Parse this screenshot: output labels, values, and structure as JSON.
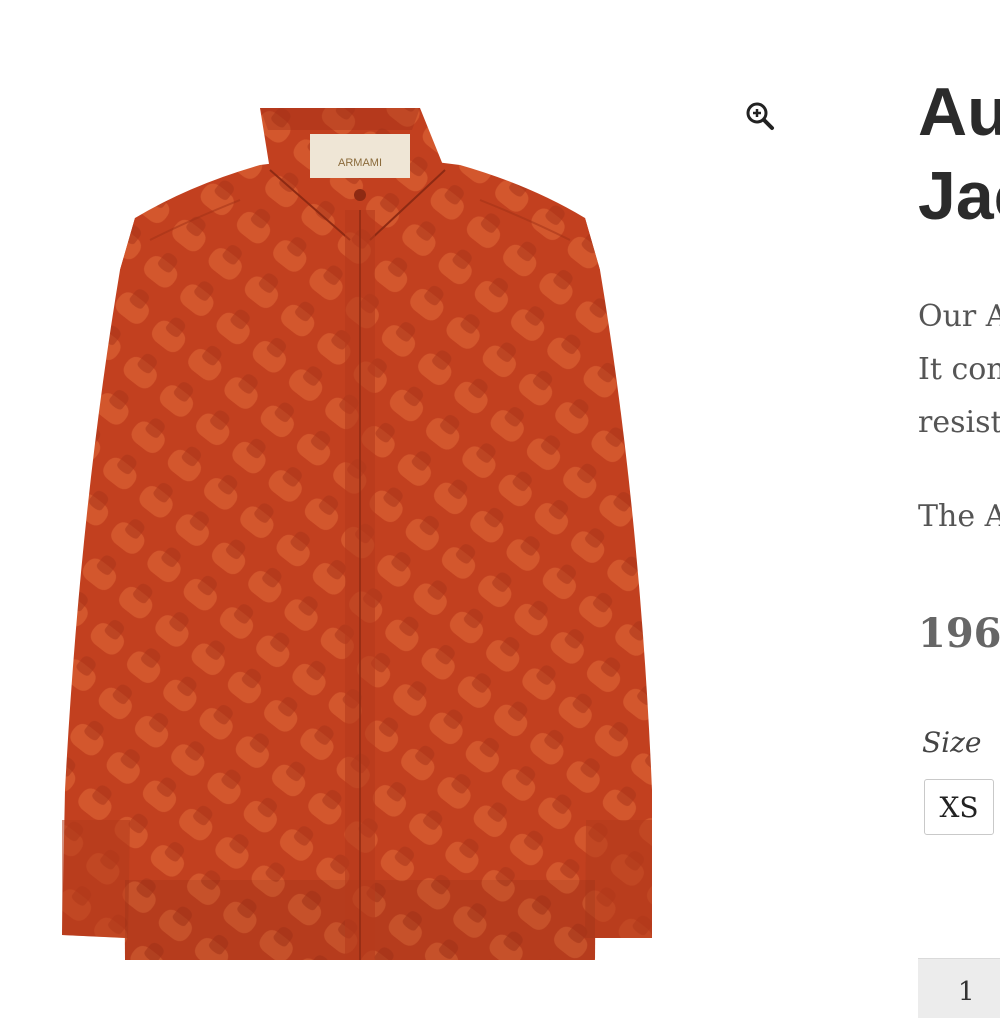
{
  "product": {
    "title_line1": "Au",
    "title_line2": "Jac",
    "description": {
      "line1": "Our A",
      "line2": "It con",
      "line3": "resist",
      "line4": "The A"
    },
    "price": "196.",
    "size_label": "Size",
    "size_options": [
      "XS"
    ],
    "quantity": "1",
    "brand_label": "ARMAMI"
  },
  "icons": {
    "zoom": "zoom-in-icon"
  },
  "colors": {
    "shirt": "#c2401f",
    "text_dark": "#2b2b2b",
    "text_body": "#555555"
  }
}
